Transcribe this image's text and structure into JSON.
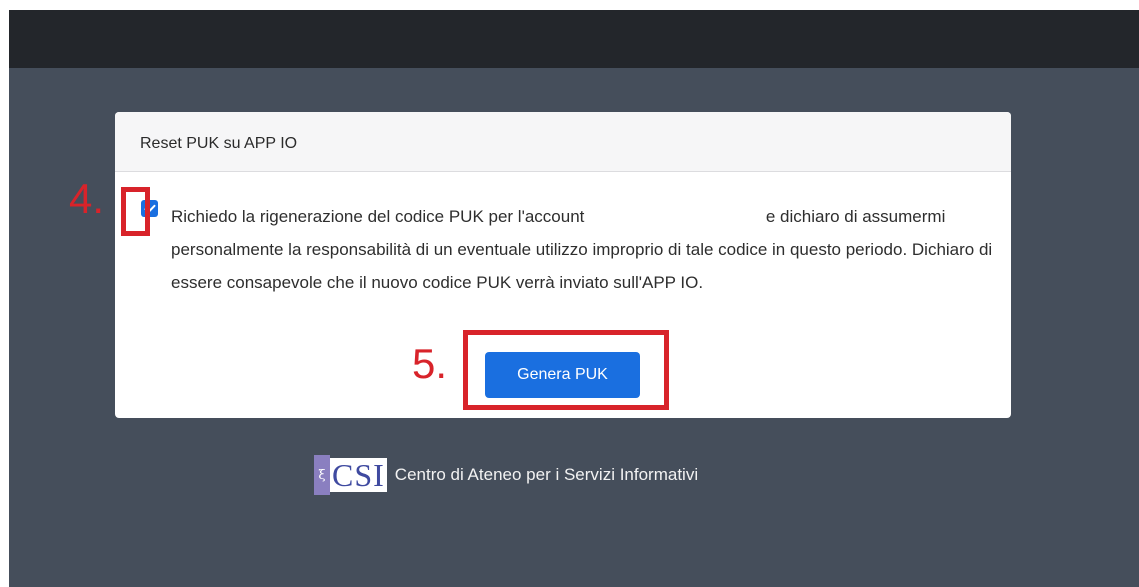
{
  "card": {
    "title": "Reset PUK su APP IO",
    "consent_part1": "Richiedo la rigenerazione del codice PUK per l'account",
    "consent_part2": "e dichiaro di assumermi personalmente la responsabilità di un eventuale utilizzo improprio di tale codice in questo periodo. Dichiaro di essere consapevole che il nuovo codice PUK verrà inviato sull'APP IO.",
    "checkbox_checked": true,
    "button_label": "Genera PUK"
  },
  "annotations": {
    "step4": "4.",
    "step5": "5."
  },
  "footer": {
    "logo_text": "CSI",
    "logo_glyph": "ξ",
    "label": "Centro di Ateneo per i Servizi Informativi"
  },
  "colors": {
    "primary": "#1a6fe0",
    "annotation": "#d8232a",
    "background": "#454e5b",
    "topbar": "#23262b"
  },
  "icons": {
    "checkbox": "checkmark-icon"
  }
}
